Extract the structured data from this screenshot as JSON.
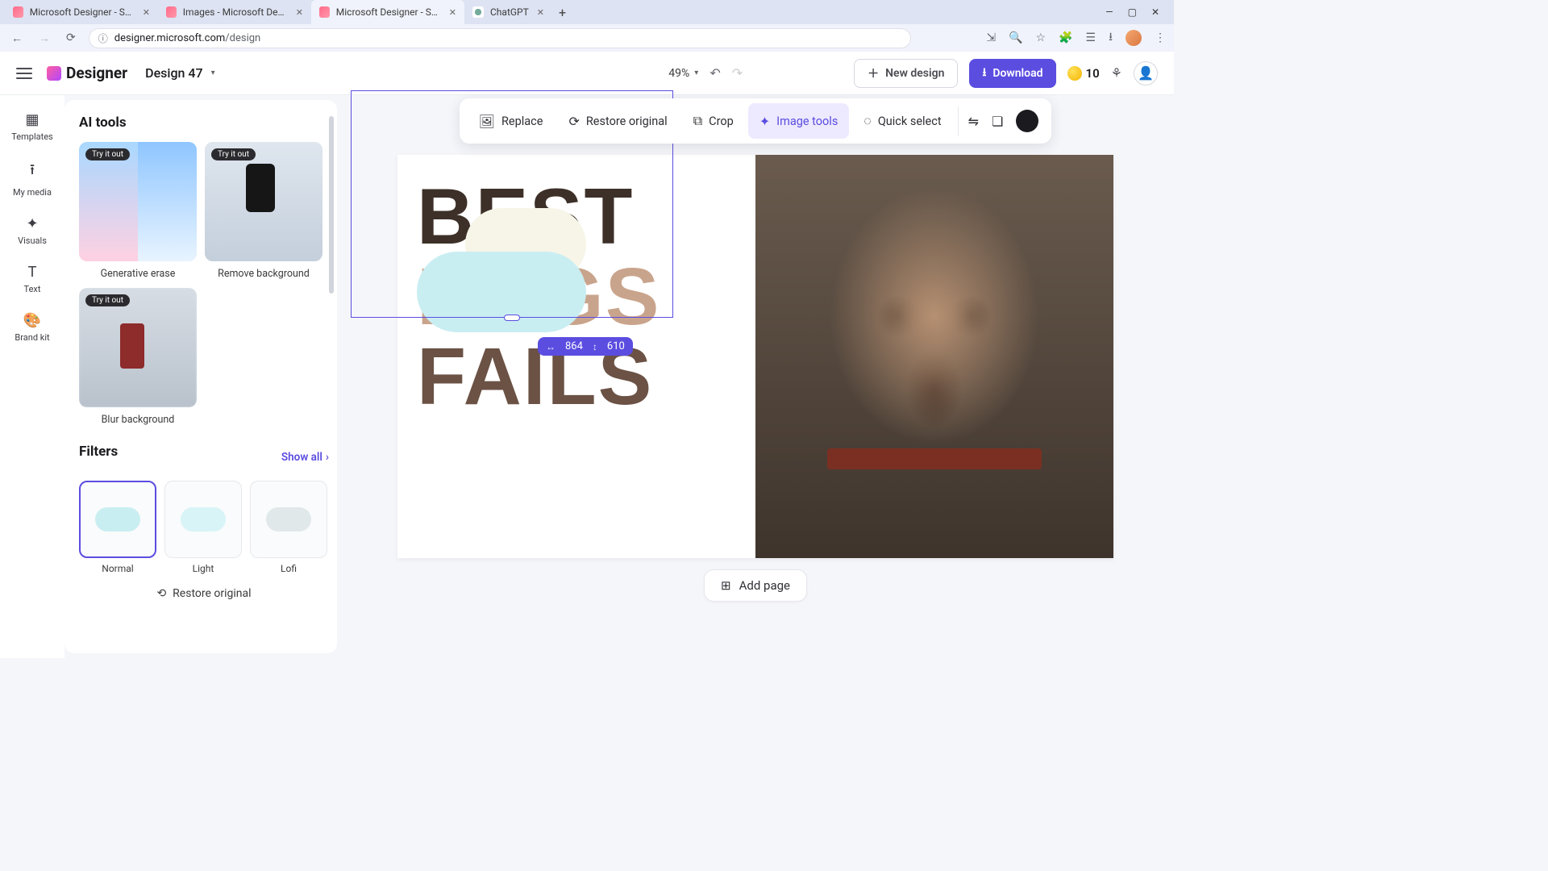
{
  "browser": {
    "tabs": [
      {
        "label": "Microsoft Designer - Stunning"
      },
      {
        "label": "Images - Microsoft Designer"
      },
      {
        "label": "Microsoft Designer - Stunning"
      },
      {
        "label": "ChatGPT"
      }
    ],
    "url_domain": "designer.microsoft.com",
    "url_path": "/design"
  },
  "header": {
    "brand": "Designer",
    "design_name": "Design 47",
    "zoom": "49%",
    "new_design": "New design",
    "download": "Download",
    "credits": "10"
  },
  "rails": {
    "templates": "Templates",
    "my_media": "My media",
    "visuals": "Visuals",
    "text": "Text",
    "brand_kit": "Brand kit"
  },
  "panel": {
    "ai_tools_title": "AI tools",
    "try_it_out": "Try it out",
    "tools": {
      "generative_erase": "Generative erase",
      "remove_background": "Remove background",
      "blur_background": "Blur background"
    },
    "filters_title": "Filters",
    "show_all": "Show all",
    "filters": {
      "normal": "Normal",
      "light": "Light",
      "lofi": "Lofi"
    },
    "restore_original": "Restore original"
  },
  "context_bar": {
    "replace": "Replace",
    "restore_original": "Restore original",
    "crop": "Crop",
    "image_tools": "Image tools",
    "quick_select": "Quick select"
  },
  "canvas": {
    "word_best": "BEST",
    "word_dogs": "DOGS",
    "word_fails": "FAILS",
    "dim_w": "864",
    "dim_h": "610"
  },
  "add_page": "Add page"
}
